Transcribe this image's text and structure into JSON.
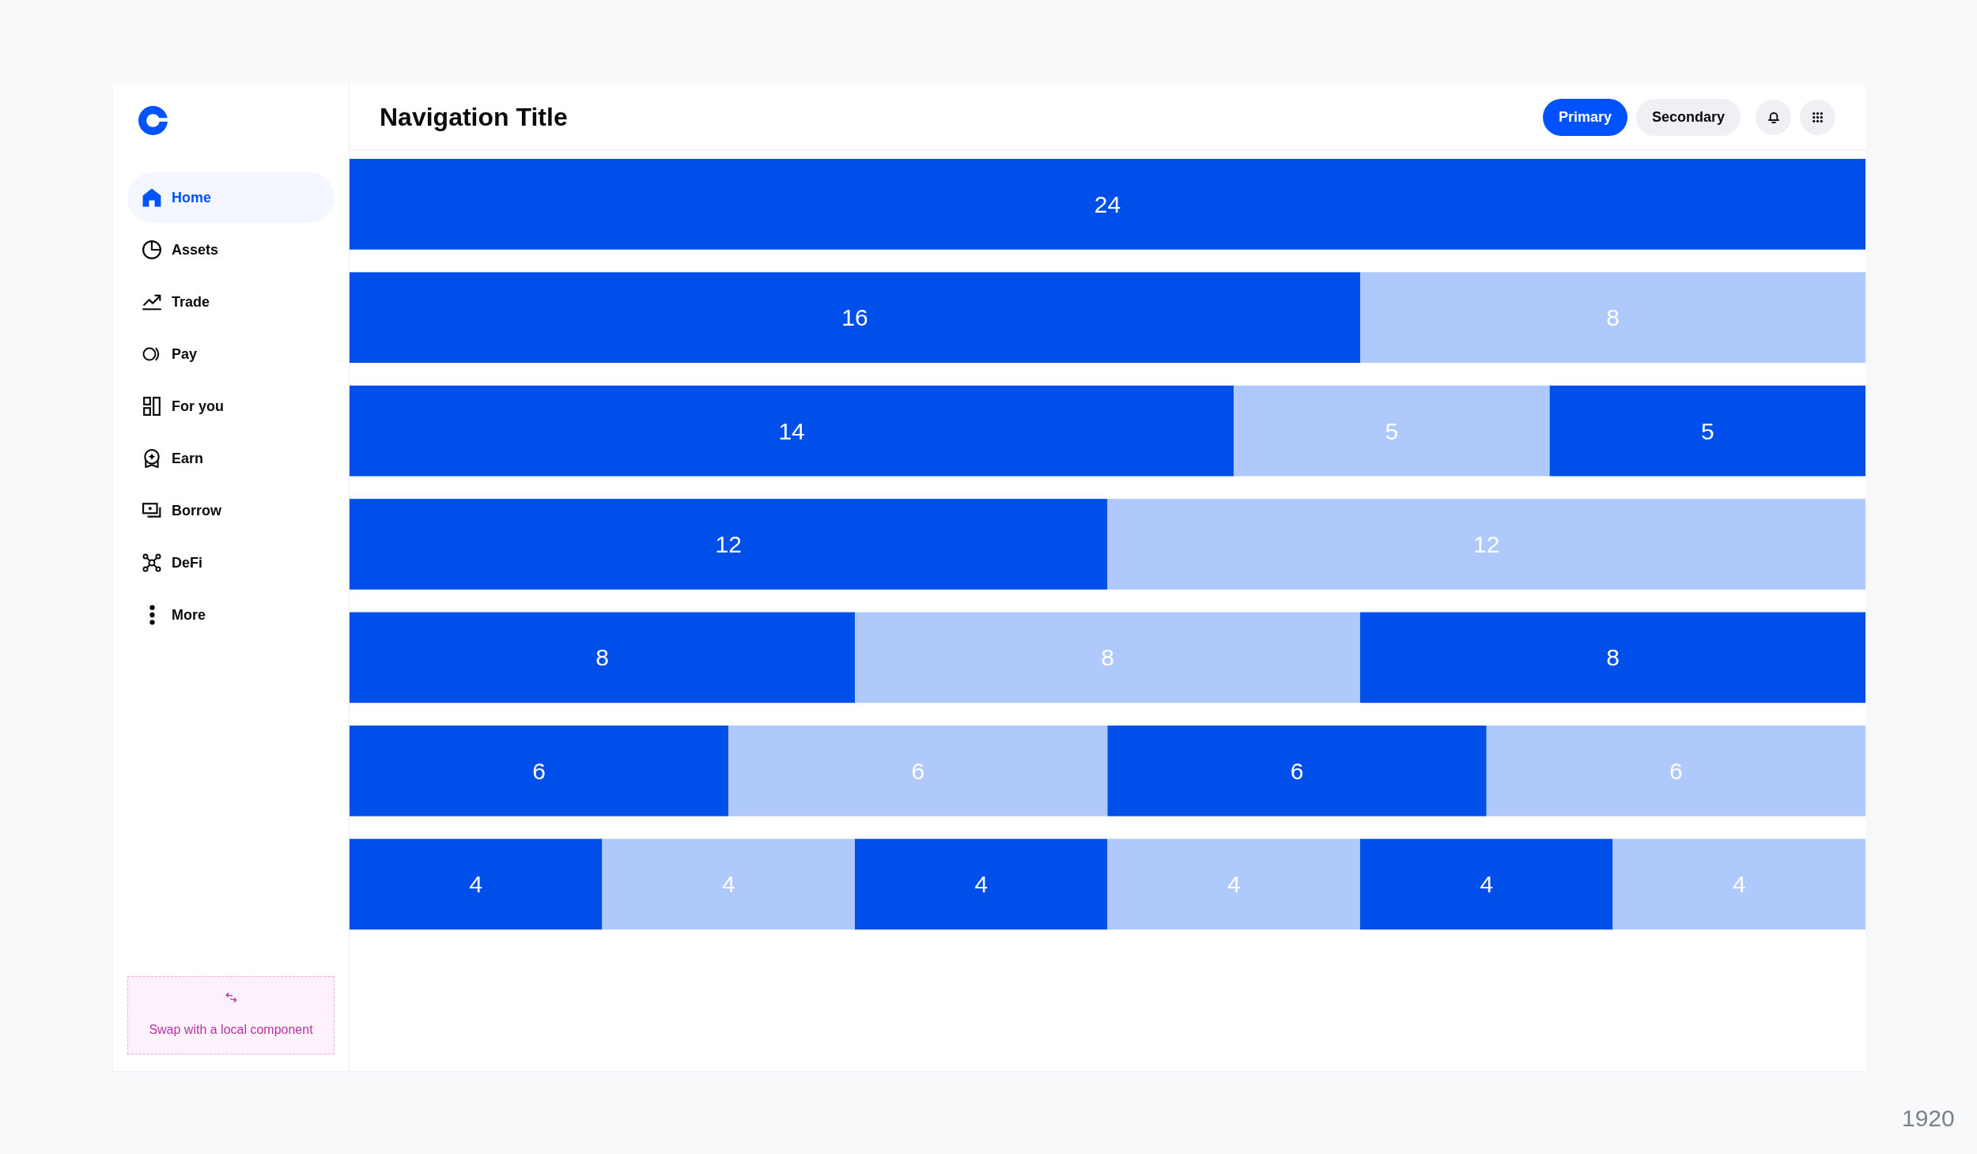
{
  "sidebar": {
    "items": [
      {
        "label": "Home",
        "selected": true
      },
      {
        "label": "Assets",
        "selected": false
      },
      {
        "label": "Trade",
        "selected": false
      },
      {
        "label": "Pay",
        "selected": false
      },
      {
        "label": "For you",
        "selected": false
      },
      {
        "label": "Earn",
        "selected": false
      },
      {
        "label": "Borrow",
        "selected": false
      },
      {
        "label": "DeFi",
        "selected": false
      },
      {
        "label": "More",
        "selected": false
      }
    ],
    "placeholder_component": {
      "text": "Swap with a local component"
    }
  },
  "header": {
    "title": "Navigation Title",
    "buttons": [
      {
        "label": "Primary",
        "kind": "primary"
      },
      {
        "label": "Secondary",
        "kind": "secondary"
      }
    ]
  },
  "main": {
    "chart_data": {
      "type": "bar",
      "orientation": "horizontal",
      "stacked": true,
      "data_labels": true,
      "categories": [
        null,
        null,
        null,
        null,
        null,
        null,
        null
      ],
      "xlim": [
        0,
        24
      ],
      "series": [
        {
          "color": "#004fea",
          "values": [
            24,
            16,
            14,
            12,
            8,
            6,
            4
          ]
        },
        {
          "color": "#b0c9fd",
          "values": [
            null,
            8,
            5,
            12,
            8,
            6,
            4
          ]
        },
        {
          "color": "#004fea",
          "values": [
            null,
            null,
            5,
            null,
            8,
            6,
            4
          ]
        },
        {
          "color": "#b0c9fd",
          "values": [
            null,
            null,
            null,
            null,
            null,
            6,
            4
          ]
        },
        {
          "color": "#004fea",
          "values": [
            null,
            null,
            null,
            null,
            null,
            null,
            4
          ]
        },
        {
          "color": "#b0c9fd",
          "values": [
            null,
            null,
            null,
            null,
            null,
            null,
            4
          ]
        }
      ]
    }
  },
  "frame_label": "1920"
}
